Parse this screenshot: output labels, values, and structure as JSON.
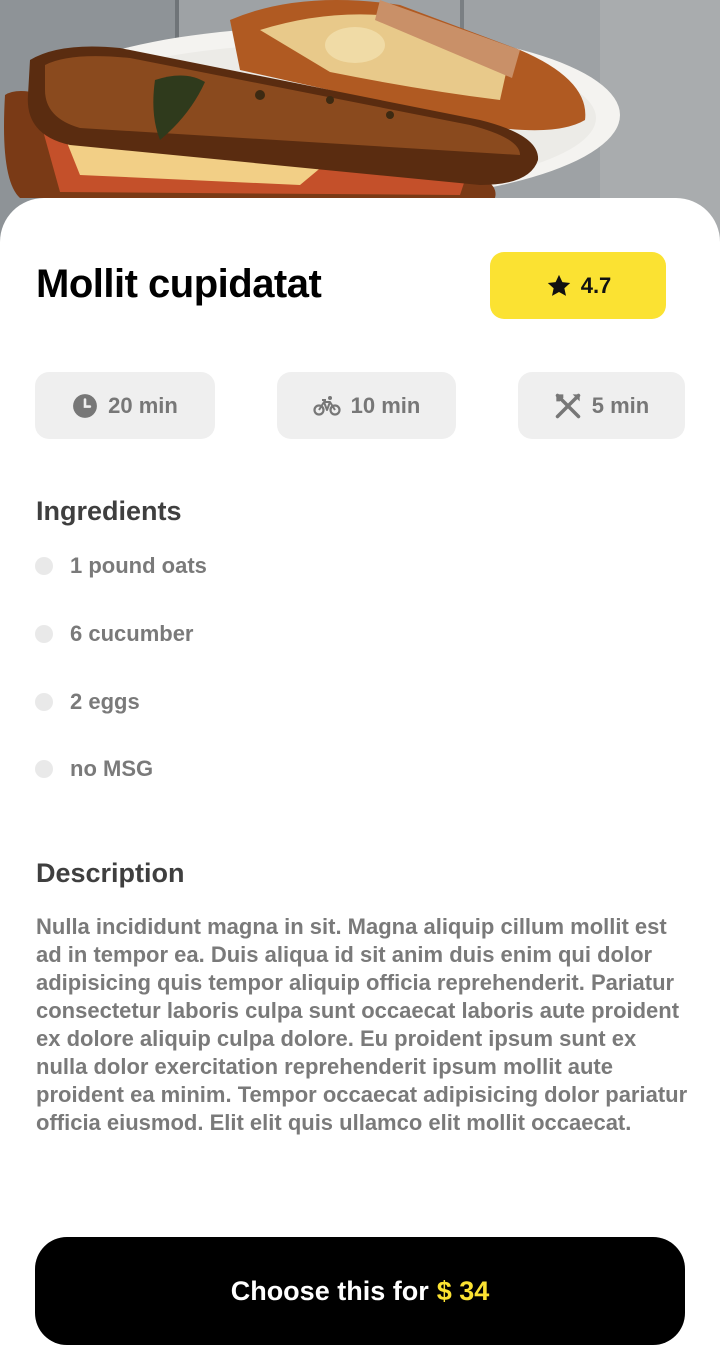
{
  "recipe": {
    "title": "Mollit cupidatat",
    "rating": "4.7"
  },
  "times": [
    {
      "icon": "clock-icon",
      "label": "20 min"
    },
    {
      "icon": "bicycle-icon",
      "label": "10 min"
    },
    {
      "icon": "utensils-icon",
      "label": "5 min"
    }
  ],
  "ingredients": {
    "title": "Ingredients",
    "items": [
      "1 pound oats",
      "6 cucumber",
      "2 eggs",
      "no MSG"
    ]
  },
  "description": {
    "title": "Description",
    "text": "Nulla incididunt magna in sit. Magna aliquip cillum mollit est ad in tempor ea. Duis aliqua id sit anim duis enim qui dolor adipisicing quis tempor aliquip officia reprehenderit. Pariatur consectetur laboris culpa sunt occaecat laboris aute proident ex dolore aliquip culpa dolore. Eu proident ipsum sunt ex nulla dolor exercitation reprehenderit ipsum mollit aute proident ea minim. Tempor occaecat adipisicing dolor pariatur officia eiusmod. Elit elit quis ullamco elit mollit occaecat."
  },
  "cta": {
    "label": "Choose this for",
    "price": "$ 34"
  },
  "colors": {
    "accent": "#fbe232",
    "cta_background": "#000000",
    "chip_background": "#efefef"
  }
}
